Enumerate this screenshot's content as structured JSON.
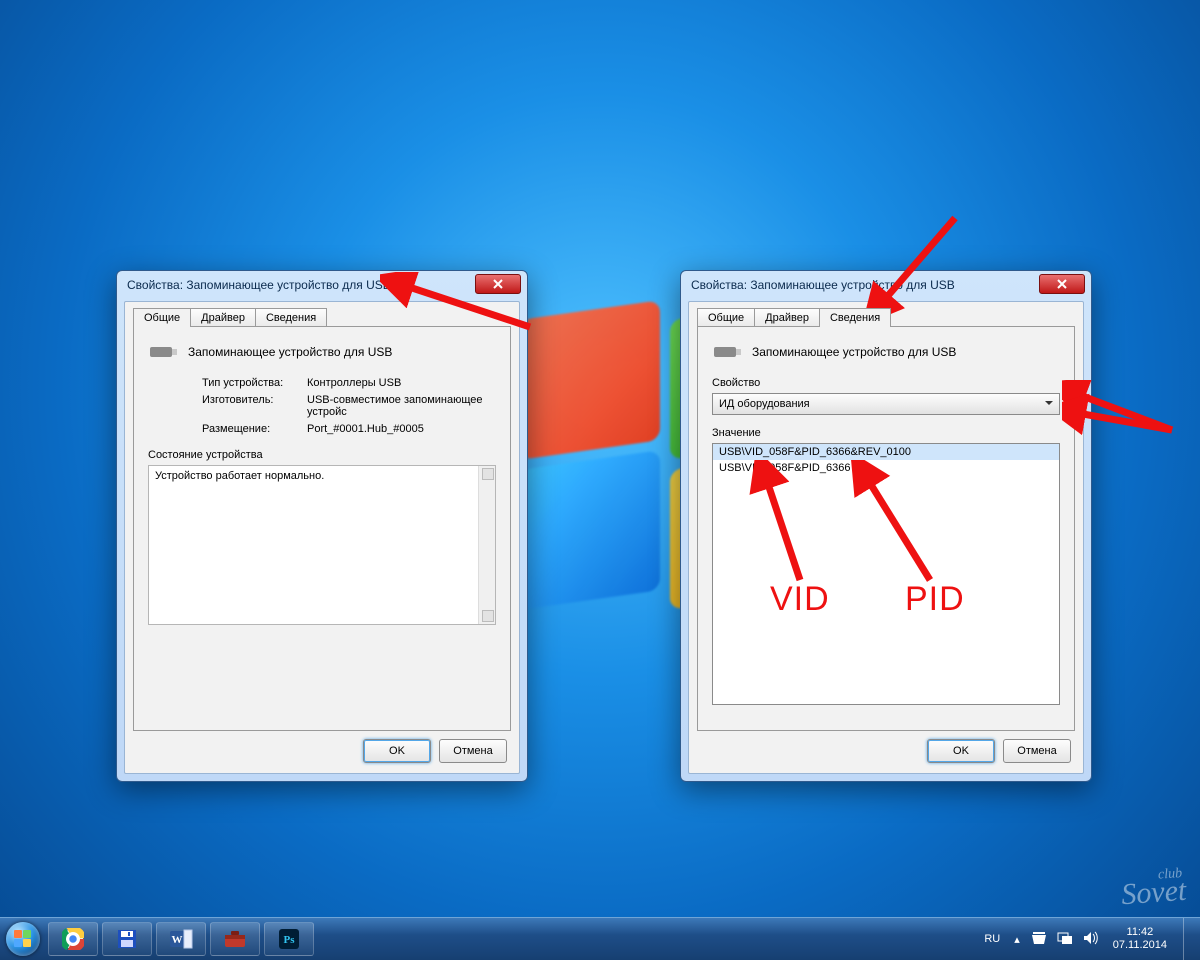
{
  "dialog_left": {
    "title": "Свойства: Запоминающее устройство для USB",
    "tabs": {
      "general": "Общие",
      "driver": "Драйвер",
      "details": "Сведения"
    },
    "active_tab": "general",
    "device_name": "Запоминающее устройство для USB",
    "rows": {
      "type_label": "Тип устройства:",
      "type_value": "Контроллеры USB",
      "vendor_label": "Изготовитель:",
      "vendor_value": "USB-совместимое запоминающее устройс",
      "location_label": "Размещение:",
      "location_value": "Port_#0001.Hub_#0005"
    },
    "status_label": "Состояние устройства",
    "status_text": "Устройство работает нормально.",
    "ok": "OK",
    "cancel": "Отмена"
  },
  "dialog_right": {
    "title": "Свойства: Запоминающее устройство для USB",
    "tabs": {
      "general": "Общие",
      "driver": "Драйвер",
      "details": "Сведения"
    },
    "active_tab": "details",
    "device_name": "Запоминающее устройство для USB",
    "property_label": "Свойство",
    "property_value": "ИД оборудования",
    "value_label": "Значение",
    "values": [
      "USB\\VID_058F&PID_6366&REV_0100",
      "USB\\VID_058F&PID_6366"
    ],
    "ok": "OK",
    "cancel": "Отмена"
  },
  "annotations": {
    "vid": "VID",
    "pid": "PID"
  },
  "taskbar": {
    "apps": [
      "chrome",
      "save",
      "word",
      "toolbox",
      "photoshop"
    ],
    "lang": "RU",
    "time": "11:42",
    "date": "07.11.2014"
  },
  "watermark": {
    "small": "club",
    "big": "Sovet"
  }
}
